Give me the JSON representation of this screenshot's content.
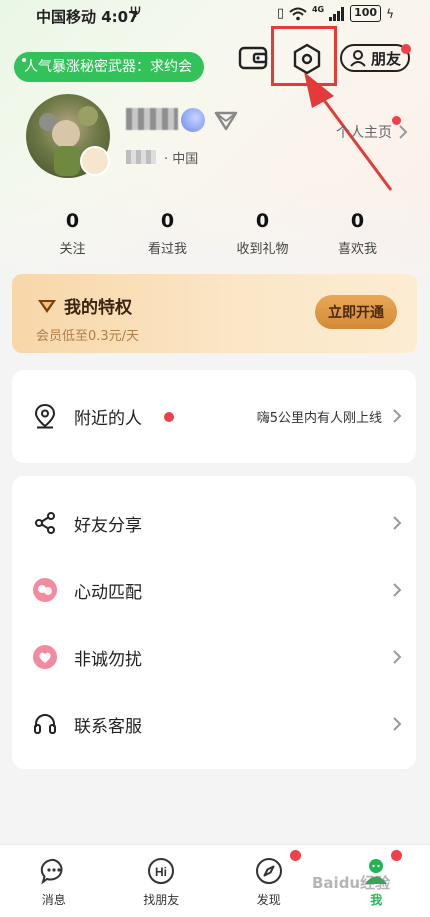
{
  "status_bar": {
    "carrier_time": "中国移动 4:07",
    "battery": "100",
    "network": "4G"
  },
  "header": {
    "promo": "人气暴涨秘密武器：求约会",
    "friends_label": "朋友"
  },
  "profile": {
    "location": "中国",
    "profile_link": "个人主页"
  },
  "stats": [
    {
      "value": "0",
      "label": "关注"
    },
    {
      "value": "0",
      "label": "看过我"
    },
    {
      "value": "0",
      "label": "收到礼物"
    },
    {
      "value": "0",
      "label": "喜欢我"
    }
  ],
  "privilege": {
    "title": "我的特权",
    "subtitle": "会员低至0.3元/天",
    "button": "立即开通"
  },
  "nearby": {
    "label": "附近的人",
    "hint": "嗨5公里内有人刚上线"
  },
  "menu": [
    {
      "label": "好友分享",
      "icon": "share-icon"
    },
    {
      "label": "心动匹配",
      "icon": "heart-match-icon"
    },
    {
      "label": "非诚勿扰",
      "icon": "no-disturb-icon"
    },
    {
      "label": "联系客服",
      "icon": "headset-icon"
    }
  ],
  "nav": [
    {
      "label": "消息",
      "icon": "message-icon"
    },
    {
      "label": "找朋友",
      "icon": "hi-icon"
    },
    {
      "label": "发现",
      "icon": "compass-icon"
    },
    {
      "label": "我",
      "icon": "me-icon",
      "active": true
    }
  ],
  "watermark": "Baidu经验",
  "colors": {
    "accent_green": "#33c25a",
    "badge_red": "#f0414b",
    "annotation_red": "#e33a3a",
    "privilege_gold": "#d48a35"
  }
}
